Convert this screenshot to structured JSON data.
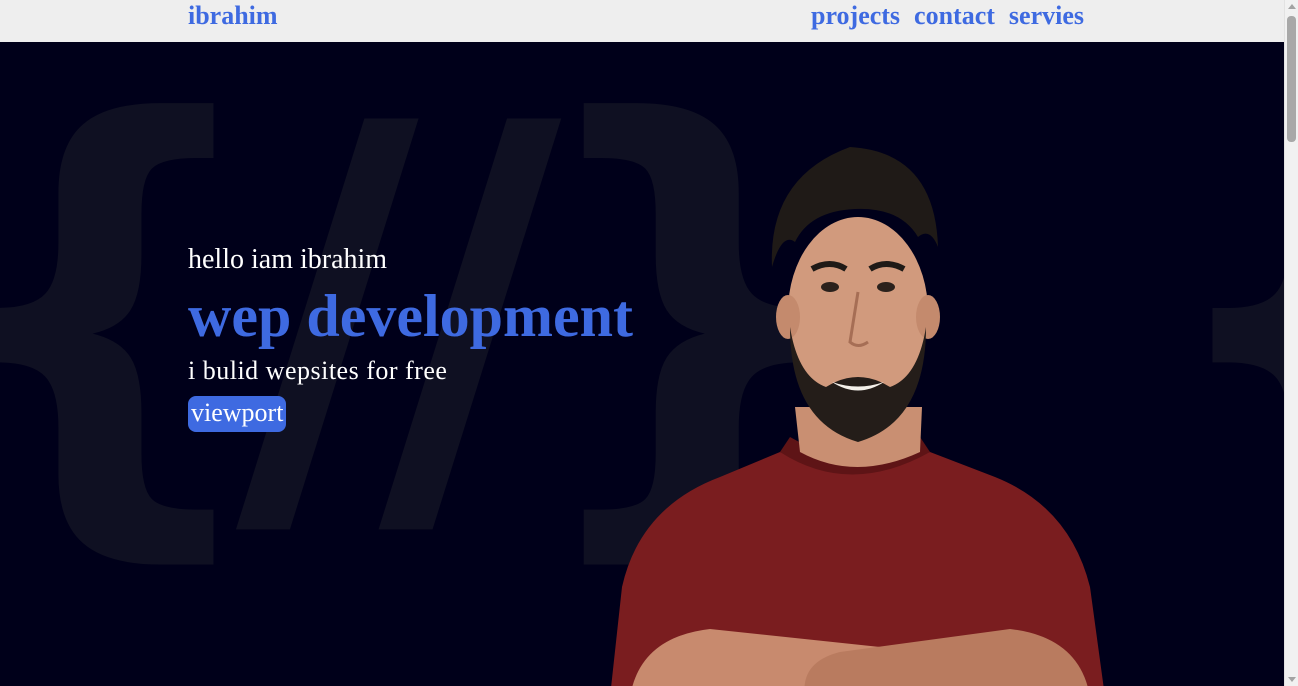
{
  "nav": {
    "brand": "ibrahim",
    "links": [
      "projects",
      "contact",
      "servies"
    ]
  },
  "hero": {
    "greeting": "hello iam ibrahim",
    "headline": "wep development",
    "tagline": "i bulid wepsites for free",
    "cta_label": "viewport",
    "background_glyphs_left": "{//}",
    "background_glyphs_right": "{"
  },
  "colors": {
    "accent": "#3e6ae1",
    "background": "#00001a",
    "navbar": "#eeeeee",
    "text": "#ffffff",
    "shirt": "#7a1d1f"
  },
  "icons": [
    "scroll-up-arrow-icon",
    "scroll-down-arrow-icon"
  ]
}
